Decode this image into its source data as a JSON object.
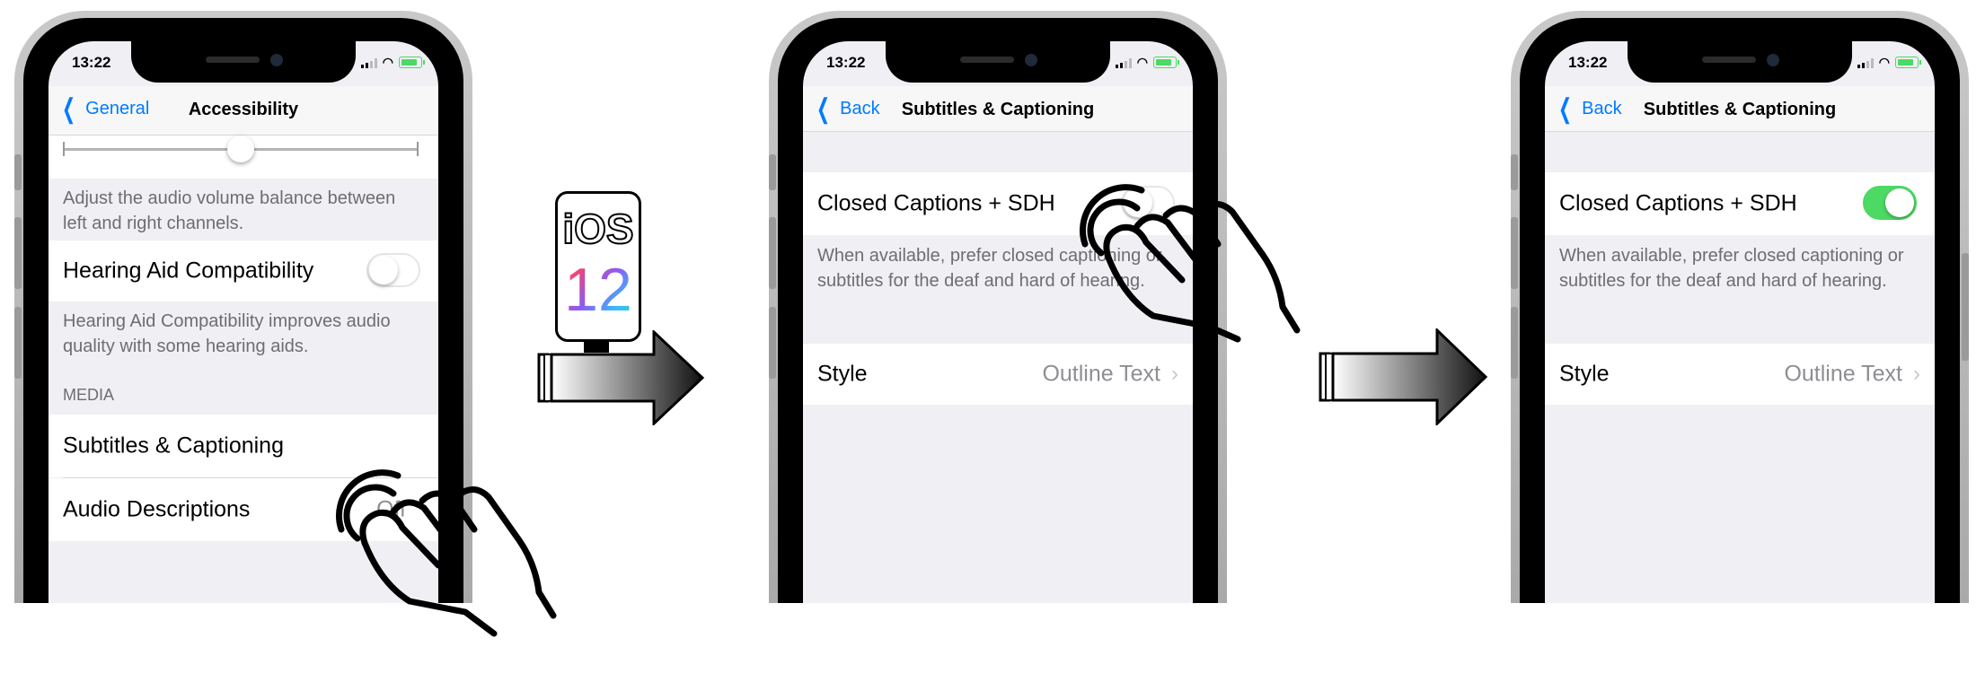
{
  "status_time": "13:22",
  "colors": {
    "ios_blue": "#007aff",
    "toggle_on": "#4cd964",
    "secondary_text": "#6d6d72",
    "value_gray": "#8e8e93"
  },
  "screen1": {
    "back_label": "General",
    "title": "Accessibility",
    "balance_slider_level": 0.5,
    "balance_footer": "Adjust the audio volume balance between left and right channels.",
    "hearing_aid_label": "Hearing Aid Compatibility",
    "hearing_aid_on": false,
    "hearing_aid_footer": "Hearing Aid Compatibility improves audio quality with some hearing aids.",
    "media_header": "MEDIA",
    "subtitles_label": "Subtitles & Captioning",
    "audio_desc_label": "Audio Descriptions",
    "audio_desc_value": "Off"
  },
  "badge": {
    "line1": "iOS",
    "line2": "12"
  },
  "screen2": {
    "back_label": "Back",
    "title": "Subtitles & Captioning",
    "cc_label": "Closed Captions + SDH",
    "cc_on": false,
    "cc_footer": "When available, prefer closed captioning or subtitles for the deaf and hard of hearing.",
    "style_label": "Style",
    "style_value": "Outline Text"
  },
  "screen3": {
    "back_label": "Back",
    "title": "Subtitles & Captioning",
    "cc_label": "Closed Captions + SDH",
    "cc_on": true,
    "cc_footer": "When available, prefer closed captioning or subtitles for the deaf and hard of hearing.",
    "style_label": "Style",
    "style_value": "Outline Text"
  },
  "icons": {
    "back": "chevron-left-icon",
    "disclosure": "chevron-right-icon",
    "tap_hand": "tap-hand-icon",
    "arrow": "right-arrow-icon"
  }
}
